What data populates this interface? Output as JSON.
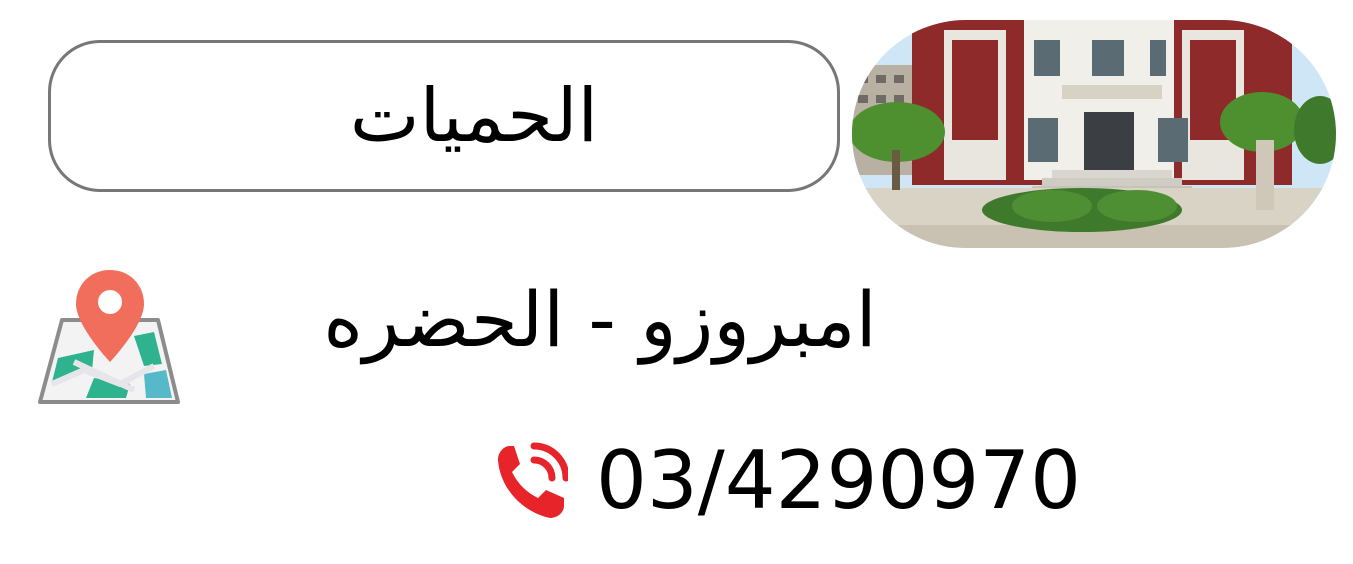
{
  "card": {
    "title": "الحميات",
    "address": "امبروزو - الحضره",
    "phone": "03/4290970"
  },
  "icons": {
    "location": "map-pin-icon",
    "phone": "phone-ringing-icon"
  },
  "colors": {
    "pin": "#F26E5C",
    "phone_icon": "#E8242B",
    "building_brick": "#8E2A2A",
    "border": "#777777"
  }
}
